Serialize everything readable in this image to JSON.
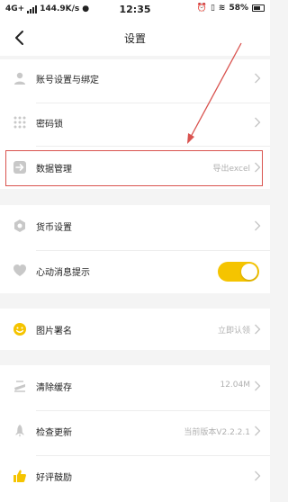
{
  "status_bar": {
    "network": "4G+",
    "speed": "144.9K/s",
    "time": "12:35",
    "battery": "58%"
  },
  "nav": {
    "title": "设置"
  },
  "rows": {
    "account": {
      "label": "账号设置与绑定"
    },
    "passcode": {
      "label": "密码锁"
    },
    "data": {
      "label": "数据管理",
      "value": "导出excel"
    },
    "currency": {
      "label": "货币设置"
    },
    "heart_notify": {
      "label": "心动消息提示",
      "toggle_on": true
    },
    "image_sign": {
      "label": "图片署名",
      "value": "立即认领"
    },
    "cache": {
      "label": "清除缓存",
      "value": "12.04M"
    },
    "update": {
      "label": "检查更新",
      "value": "当前版本V2.2.2.1"
    },
    "rate": {
      "label": "好评鼓励"
    }
  },
  "colors": {
    "accent": "#f5c400",
    "icon_gray": "#c8c8c8",
    "highlight": "#d9534f"
  }
}
